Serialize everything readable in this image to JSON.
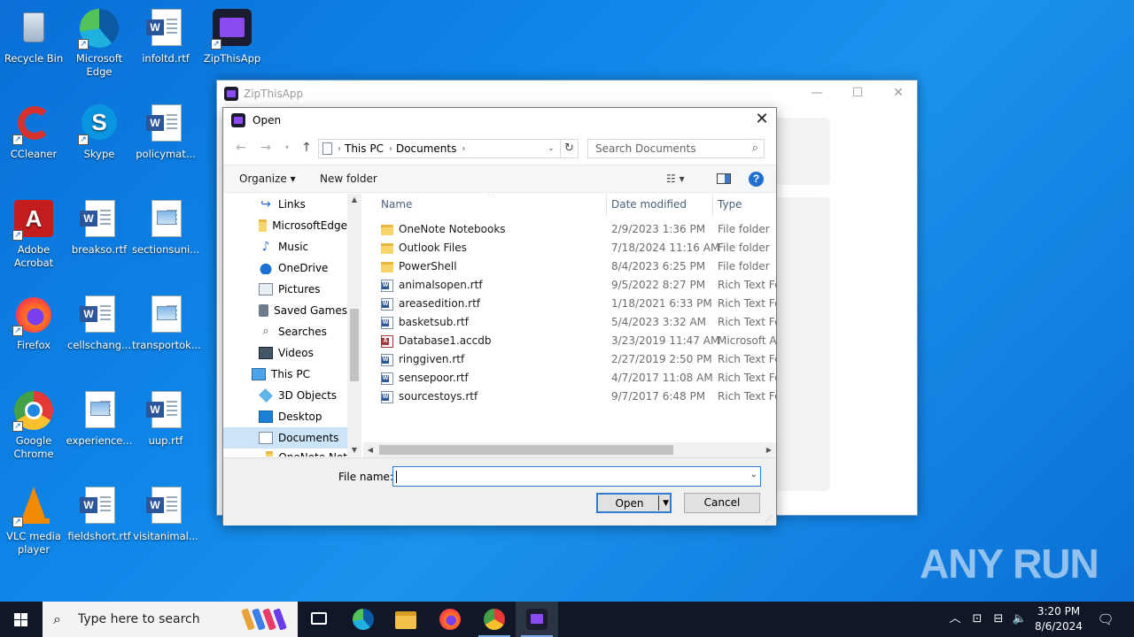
{
  "desktop": {
    "icons": [
      {
        "label": "Recycle Bin"
      },
      {
        "label": "Microsoft Edge"
      },
      {
        "label": "infoltd.rtf"
      },
      {
        "label": "ZipThisApp"
      },
      {
        "label": "CCleaner"
      },
      {
        "label": "Skype"
      },
      {
        "label": "policymat..."
      },
      {
        "label": "Adobe Acrobat"
      },
      {
        "label": "breakso.rtf"
      },
      {
        "label": "sectionsuni..."
      },
      {
        "label": "Firefox"
      },
      {
        "label": "cellschang..."
      },
      {
        "label": "transportok..."
      },
      {
        "label": "Google Chrome"
      },
      {
        "label": "experience..."
      },
      {
        "label": "uup.rtf"
      },
      {
        "label": "VLC media player"
      },
      {
        "label": "fieldshort.rtf"
      },
      {
        "label": "visitanimal..."
      }
    ]
  },
  "zip_window": {
    "title": "ZipThisApp"
  },
  "dialog": {
    "title": "Open",
    "breadcrumb": [
      "This PC",
      "Documents"
    ],
    "search_placeholder": "Search Documents",
    "organize_label": "Organize ▾",
    "new_folder_label": "New folder",
    "nav_tree": [
      {
        "label": "Links",
        "icon": "links"
      },
      {
        "label": "MicrosoftEdge",
        "icon": "folder"
      },
      {
        "label": "Music",
        "icon": "music"
      },
      {
        "label": "OneDrive",
        "icon": "cloud"
      },
      {
        "label": "Pictures",
        "icon": "pics"
      },
      {
        "label": "Saved Games",
        "icon": "games"
      },
      {
        "label": "Searches",
        "icon": "searches"
      },
      {
        "label": "Videos",
        "icon": "videos"
      },
      {
        "label": "This PC",
        "icon": "pc"
      },
      {
        "label": "3D Objects",
        "icon": "obj3d"
      },
      {
        "label": "Desktop",
        "icon": "desktop"
      },
      {
        "label": "Documents",
        "icon": "docs"
      },
      {
        "label": "OneNote Not",
        "icon": "folder"
      }
    ],
    "columns": {
      "name": "Name",
      "date": "Date modified",
      "type": "Type"
    },
    "files": [
      {
        "name": "OneNote Notebooks",
        "date": "2/9/2023 1:36 PM",
        "type": "File folder",
        "kind": "folder"
      },
      {
        "name": "Outlook Files",
        "date": "7/18/2024 11:16 AM",
        "type": "File folder",
        "kind": "folder"
      },
      {
        "name": "PowerShell",
        "date": "8/4/2023 6:25 PM",
        "type": "File folder",
        "kind": "folder"
      },
      {
        "name": "animalsopen.rtf",
        "date": "9/5/2022 8:27 PM",
        "type": "Rich Text For",
        "kind": "rtf"
      },
      {
        "name": "areasedition.rtf",
        "date": "1/18/2021 6:33 PM",
        "type": "Rich Text For",
        "kind": "rtf"
      },
      {
        "name": "basketsub.rtf",
        "date": "5/4/2023 3:32 AM",
        "type": "Rich Text For",
        "kind": "rtf"
      },
      {
        "name": "Database1.accdb",
        "date": "3/23/2019 11:47 AM",
        "type": "Microsoft Ac",
        "kind": "accdb"
      },
      {
        "name": "ringgiven.rtf",
        "date": "2/27/2019 2:50 PM",
        "type": "Rich Text For",
        "kind": "rtf"
      },
      {
        "name": "sensepoor.rtf",
        "date": "4/7/2017 11:08 AM",
        "type": "Rich Text For",
        "kind": "rtf"
      },
      {
        "name": "sourcestoys.rtf",
        "date": "9/7/2017 6:48 PM",
        "type": "Rich Text For",
        "kind": "rtf"
      }
    ],
    "file_name_label": "File name:",
    "file_name_value": "",
    "open_label": "Open",
    "cancel_label": "Cancel"
  },
  "taskbar": {
    "search_placeholder": "Type here to search",
    "time": "3:20 PM",
    "date": "8/6/2024"
  },
  "watermark": "ANY RUN"
}
